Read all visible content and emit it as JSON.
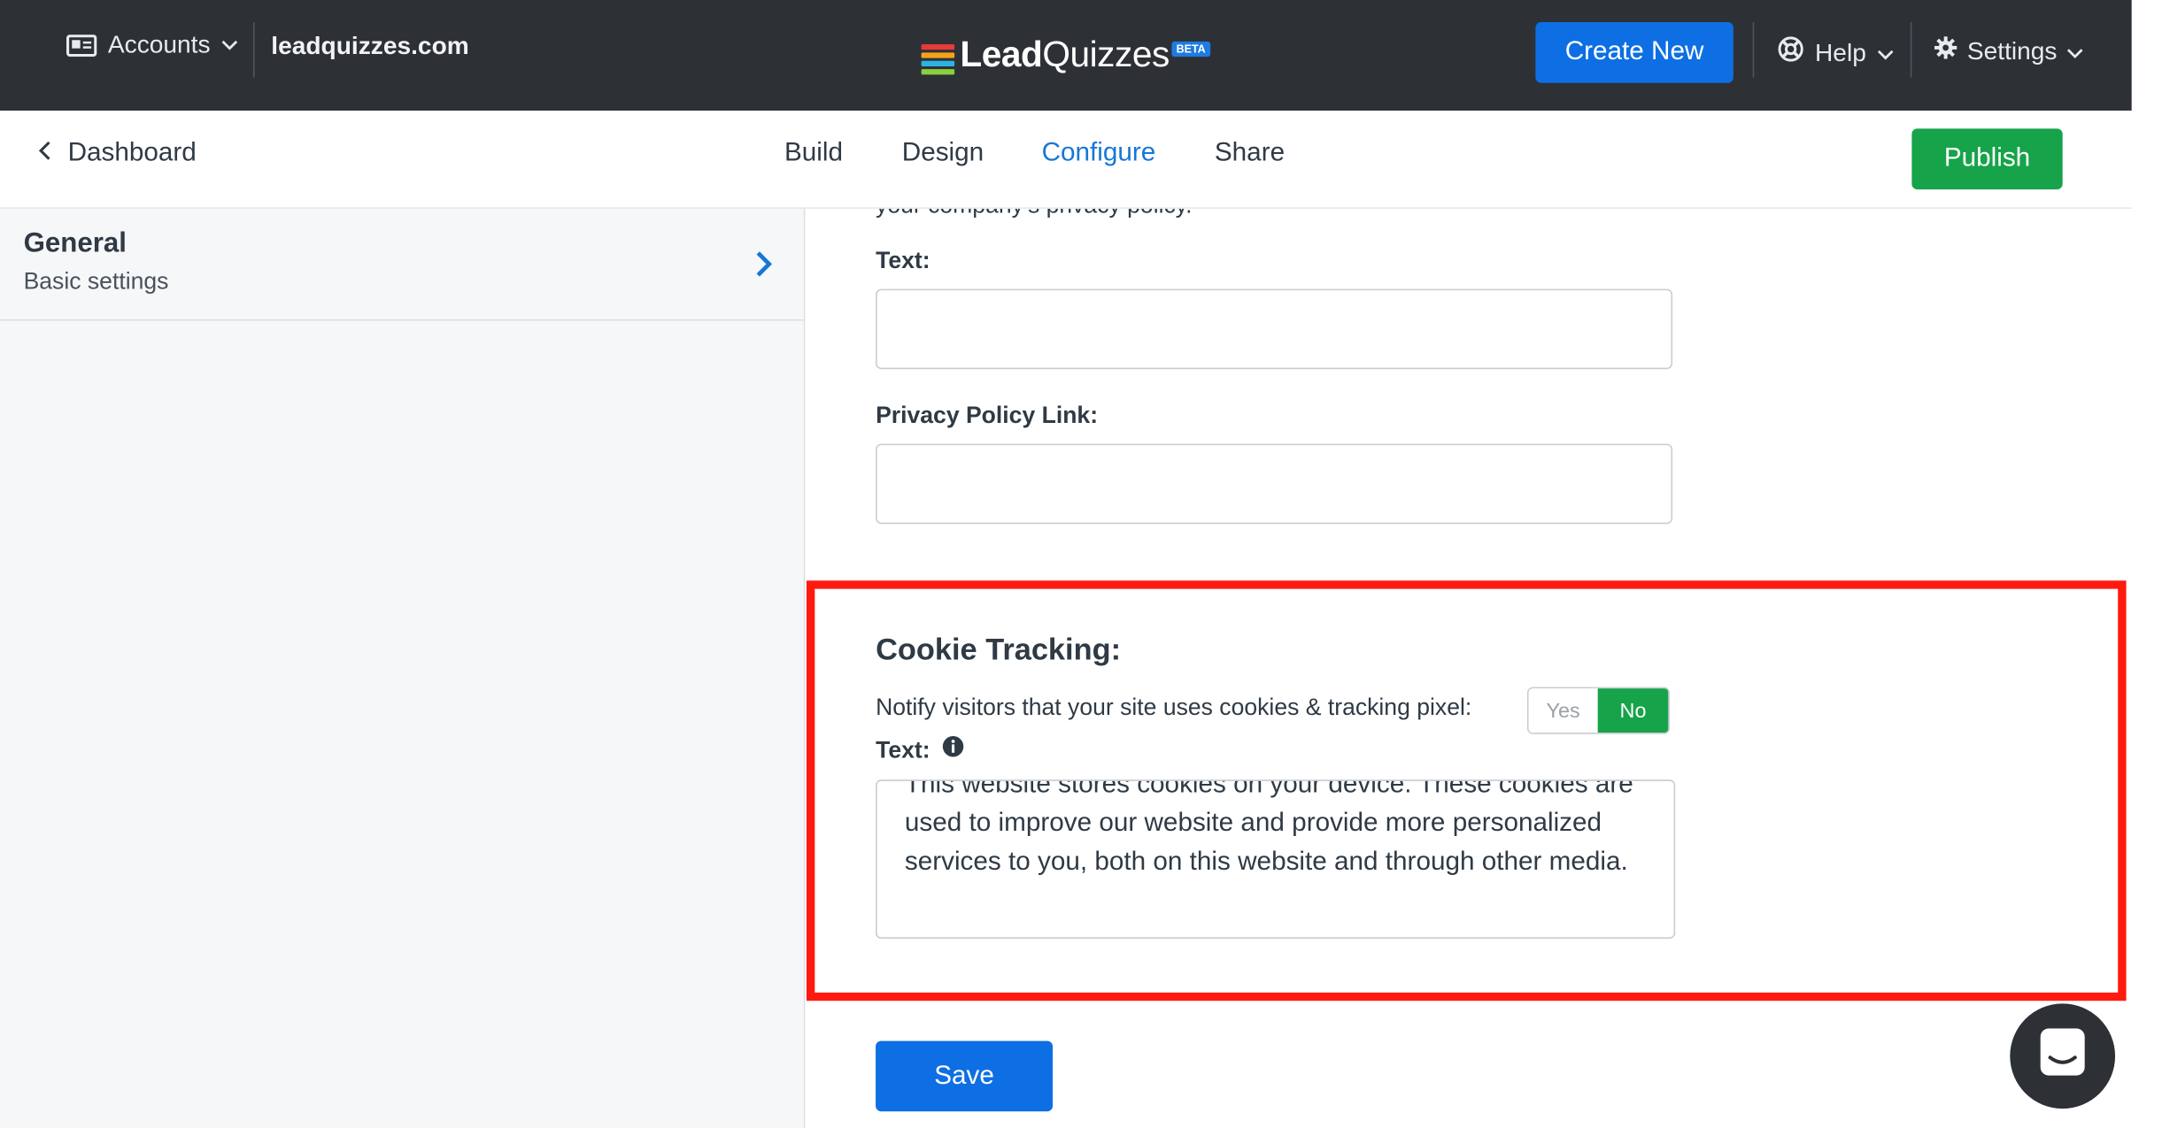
{
  "header": {
    "accounts_label": "Accounts",
    "domain": "leadquizzes.com",
    "logo_text_bold": "Lead",
    "logo_text_regular": "Quizzes",
    "logo_badge": "BETA",
    "create_new": "Create New",
    "help": "Help",
    "settings": "Settings"
  },
  "subnav": {
    "back_label": "Dashboard",
    "tabs": [
      {
        "label": "Build"
      },
      {
        "label": "Design"
      },
      {
        "label": "Configure",
        "active": true
      },
      {
        "label": "Share"
      }
    ],
    "publish": "Publish"
  },
  "sidebar": {
    "items": [
      {
        "title": "General",
        "subtitle": "Basic settings"
      }
    ]
  },
  "form": {
    "clipped_text": "your company's privacy policy.",
    "text_label": "Text:",
    "text_value": "",
    "privacy_link_label": "Privacy Policy Link:",
    "privacy_link_value": "",
    "cookie_title": "Cookie Tracking:",
    "notify_label": "Notify visitors that your site uses cookies & tracking pixel:",
    "toggle_yes": "Yes",
    "toggle_no": "No",
    "toggle_selected": "No",
    "cookie_text_label": "Text:",
    "cookie_text_value": "This website stores cookies on your device. These cookies are used to improve our website and provide more personalized services to you, both on this website and through other media.",
    "save": "Save"
  },
  "colors": {
    "topbar": "#2d3135",
    "primary_blue": "#0d6fe3",
    "publish_green": "#17a34a",
    "active_tab": "#1777d6",
    "highlight_red": "#ff1a0f"
  },
  "icons": {
    "accounts": "id-card-icon",
    "help": "lifebuoy-icon",
    "settings": "gear-icon",
    "back": "chevron-left-icon",
    "sidebar": "chevron-right-icon",
    "info": "info-circle-icon",
    "chat": "chat-bubble-icon"
  }
}
